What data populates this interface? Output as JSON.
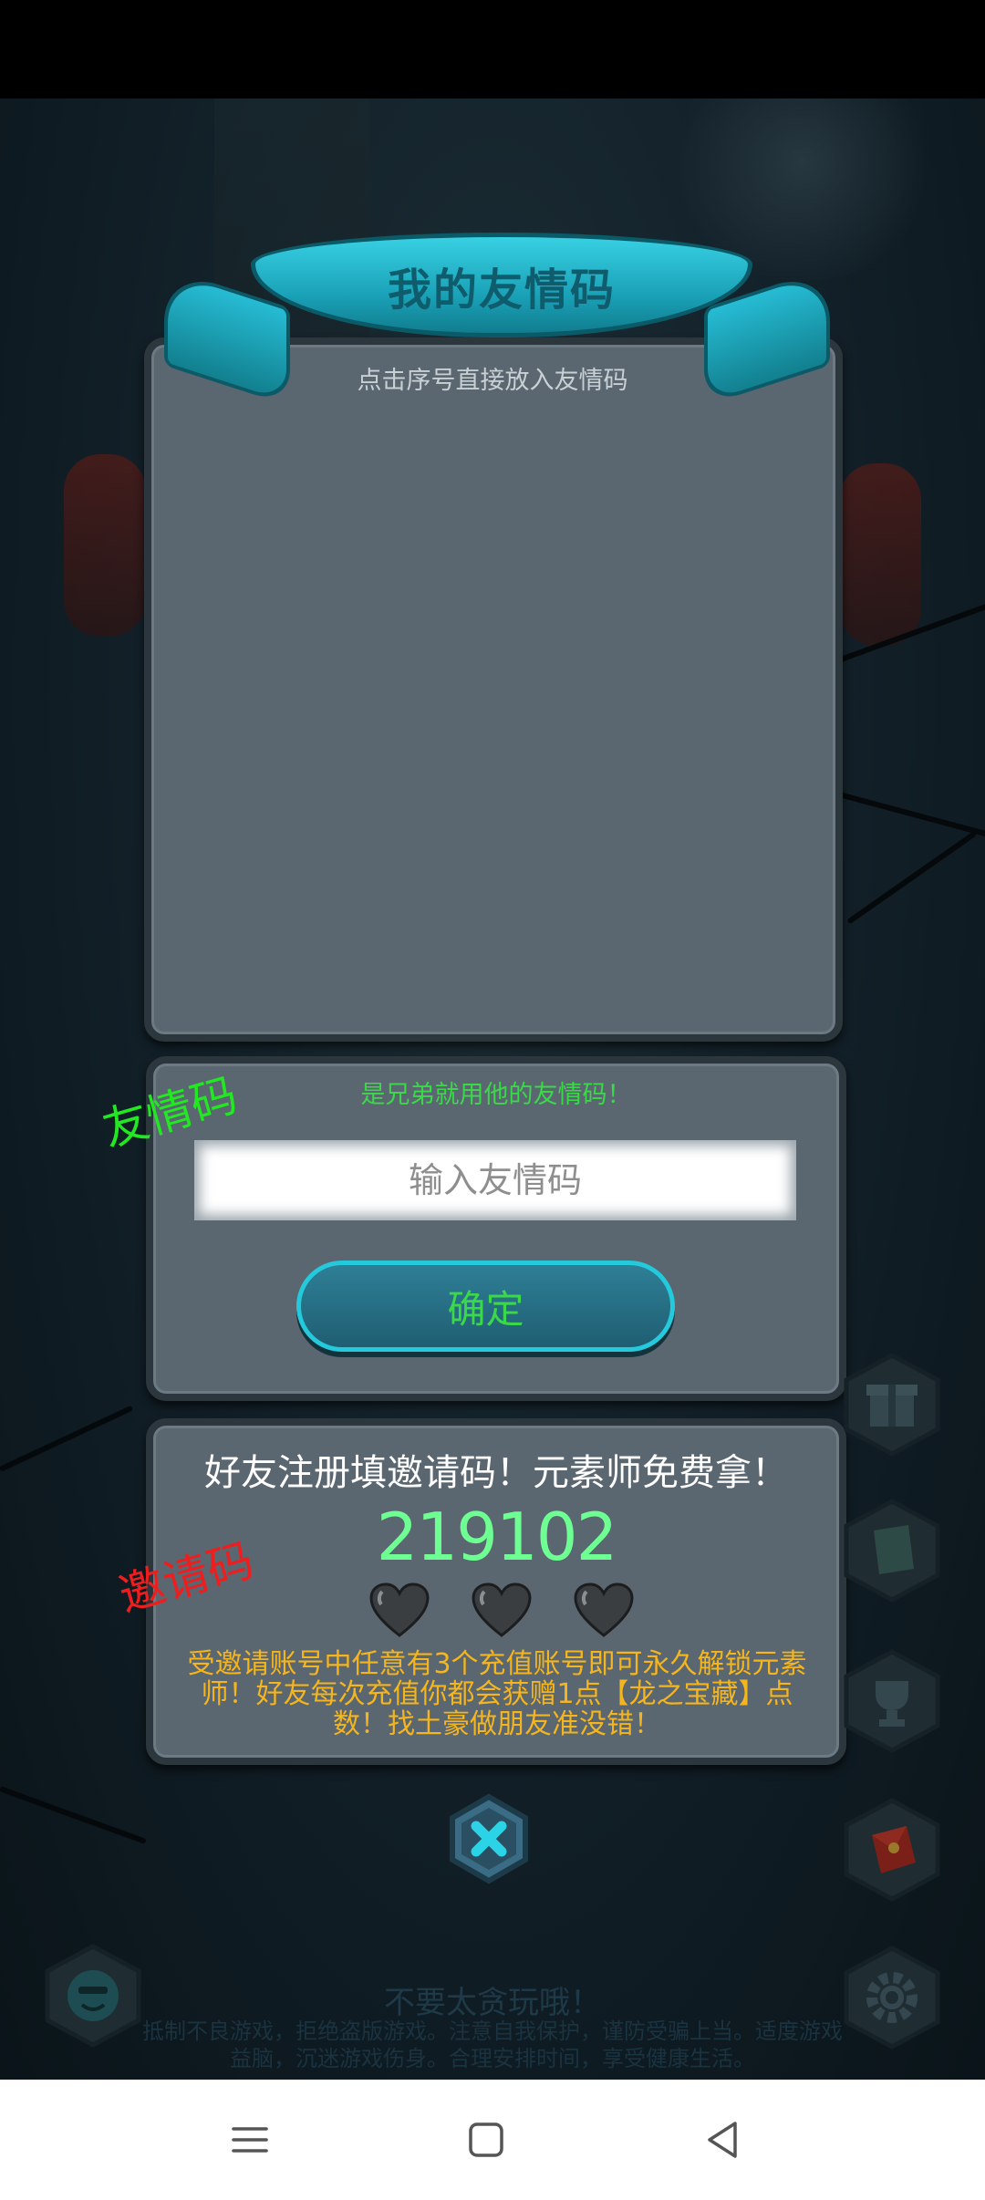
{
  "dialog": {
    "title": "我的友情码",
    "hint": "点击序号直接放入友情码"
  },
  "friend_code_section": {
    "prompt": "是兄弟就用他的友情码！",
    "input_placeholder": "输入友情码",
    "input_value": "",
    "confirm_label": "确定",
    "stamp_label": "友情码"
  },
  "invite_section": {
    "title": "好友注册填邀请码！元素师免费拿！",
    "code": "219102",
    "hearts_filled": 0,
    "hearts_total": 3,
    "description": "受邀请账号中任意有3个充值账号即可永久解锁元素师！好友每次充值你都会获赠1点【龙之宝藏】点数！找土豪做朋友准没错！",
    "stamp_label": "邀请码"
  },
  "footer": {
    "warning": "不要太贪玩哦！",
    "notice": "抵制不良游戏，拒绝盗版游戏。注意自我保护，谨防受骗上当。适度游戏益脑，沉迷游戏伤身。合理安排时间，享受健康生活。"
  },
  "side_icons": [
    "gift-icon",
    "card-icon",
    "trophy-icon",
    "red-envelope-icon",
    "gear-icon",
    "smiley-icon"
  ],
  "colors": {
    "accent_green": "#3bd84a",
    "code_green": "#6dff92",
    "desc_yellow": "#f4b51e",
    "ribbon_teal": "#1aa2b8",
    "panel": "#5a6670"
  }
}
